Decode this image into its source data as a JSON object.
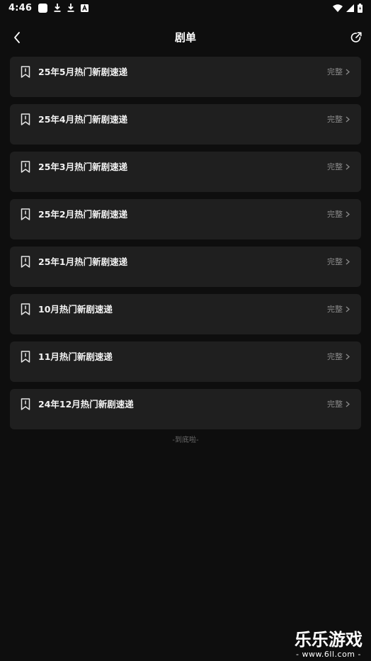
{
  "status_bar": {
    "time": "4:46",
    "icons": [
      "app-square-icon",
      "download-icon",
      "download-icon",
      "a-badge-icon",
      "wifi-icon",
      "signal-icon",
      "battery-icon"
    ]
  },
  "header": {
    "title": "剧单",
    "back_icon": "chevron-left-icon",
    "share_icon": "share-icon"
  },
  "lists": [
    {
      "title": "25年5月热门新剧速递",
      "status": "完整"
    },
    {
      "title": "25年4月热门新剧速递",
      "status": "完整"
    },
    {
      "title": "25年3月热门新剧速递",
      "status": "完整"
    },
    {
      "title": "25年2月热门新剧速递",
      "status": "完整"
    },
    {
      "title": "25年1月热门新剧速递",
      "status": "完整"
    },
    {
      "title": "10月热门新剧速递",
      "status": "完整"
    },
    {
      "title": "11月热门新剧速递",
      "status": "完整"
    },
    {
      "title": "24年12月热门新剧速递",
      "status": "完整"
    }
  ],
  "footer": {
    "end_text": "-到底啦-"
  },
  "watermark": {
    "main": "乐乐游戏",
    "sub": "- www.6ll.com -"
  },
  "colors": {
    "background": "#0e0e0e",
    "card": "#1f1f1f",
    "muted_text": "#8a8a8a"
  }
}
